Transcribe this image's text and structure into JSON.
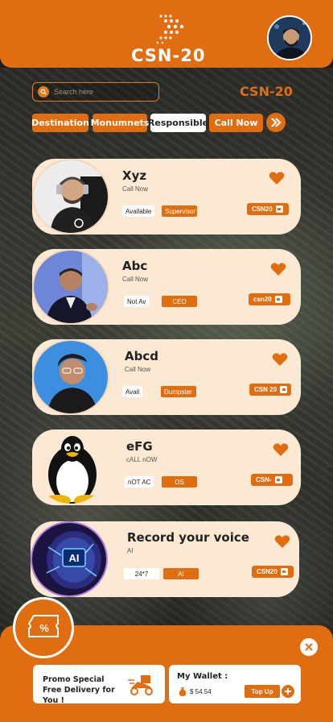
{
  "app": {
    "logo_text": "CSN-20",
    "brand_text": "CSN-20"
  },
  "search": {
    "placeholder": "Search here"
  },
  "tabs": [
    {
      "label": "Destination",
      "active": false
    },
    {
      "label": "Monumnets",
      "active": false
    },
    {
      "label": "Responsible",
      "active": true
    },
    {
      "label": "Call Now",
      "active": false
    }
  ],
  "cards": [
    {
      "name": "Xyz",
      "sub": "Call Now",
      "status": "Available",
      "role": "Supervisor",
      "tag": "CSN20",
      "photo": "man-with-headphones"
    },
    {
      "name": "Abc",
      "sub": "Call Now",
      "status": "Not Av",
      "role": "CEO",
      "tag": "csn20",
      "photo": "man-presenting"
    },
    {
      "name": "Abcd",
      "sub": "Call Now",
      "status": "Avail",
      "role": "Dumpster",
      "tag": "CSN 20",
      "photo": "young-man-glasses"
    },
    {
      "name": "eFG",
      "sub": "cALL nOW",
      "status": "nOT AC",
      "role": "OS",
      "tag": "CSN-",
      "photo": "linux-penguin"
    },
    {
      "name": "Record your voice",
      "sub": "AI",
      "status": "24*7",
      "role": "AI",
      "tag": "CSN20",
      "photo": "ai-brain"
    }
  ],
  "bottom": {
    "promo": "Promo Special Free Delivery for You !",
    "wallet_title": "My Wallet :",
    "wallet_balance": "$ 54.54",
    "topup_label": "Top Up"
  },
  "colors": {
    "accent": "#e06d10",
    "card": "#fbe9d4"
  }
}
